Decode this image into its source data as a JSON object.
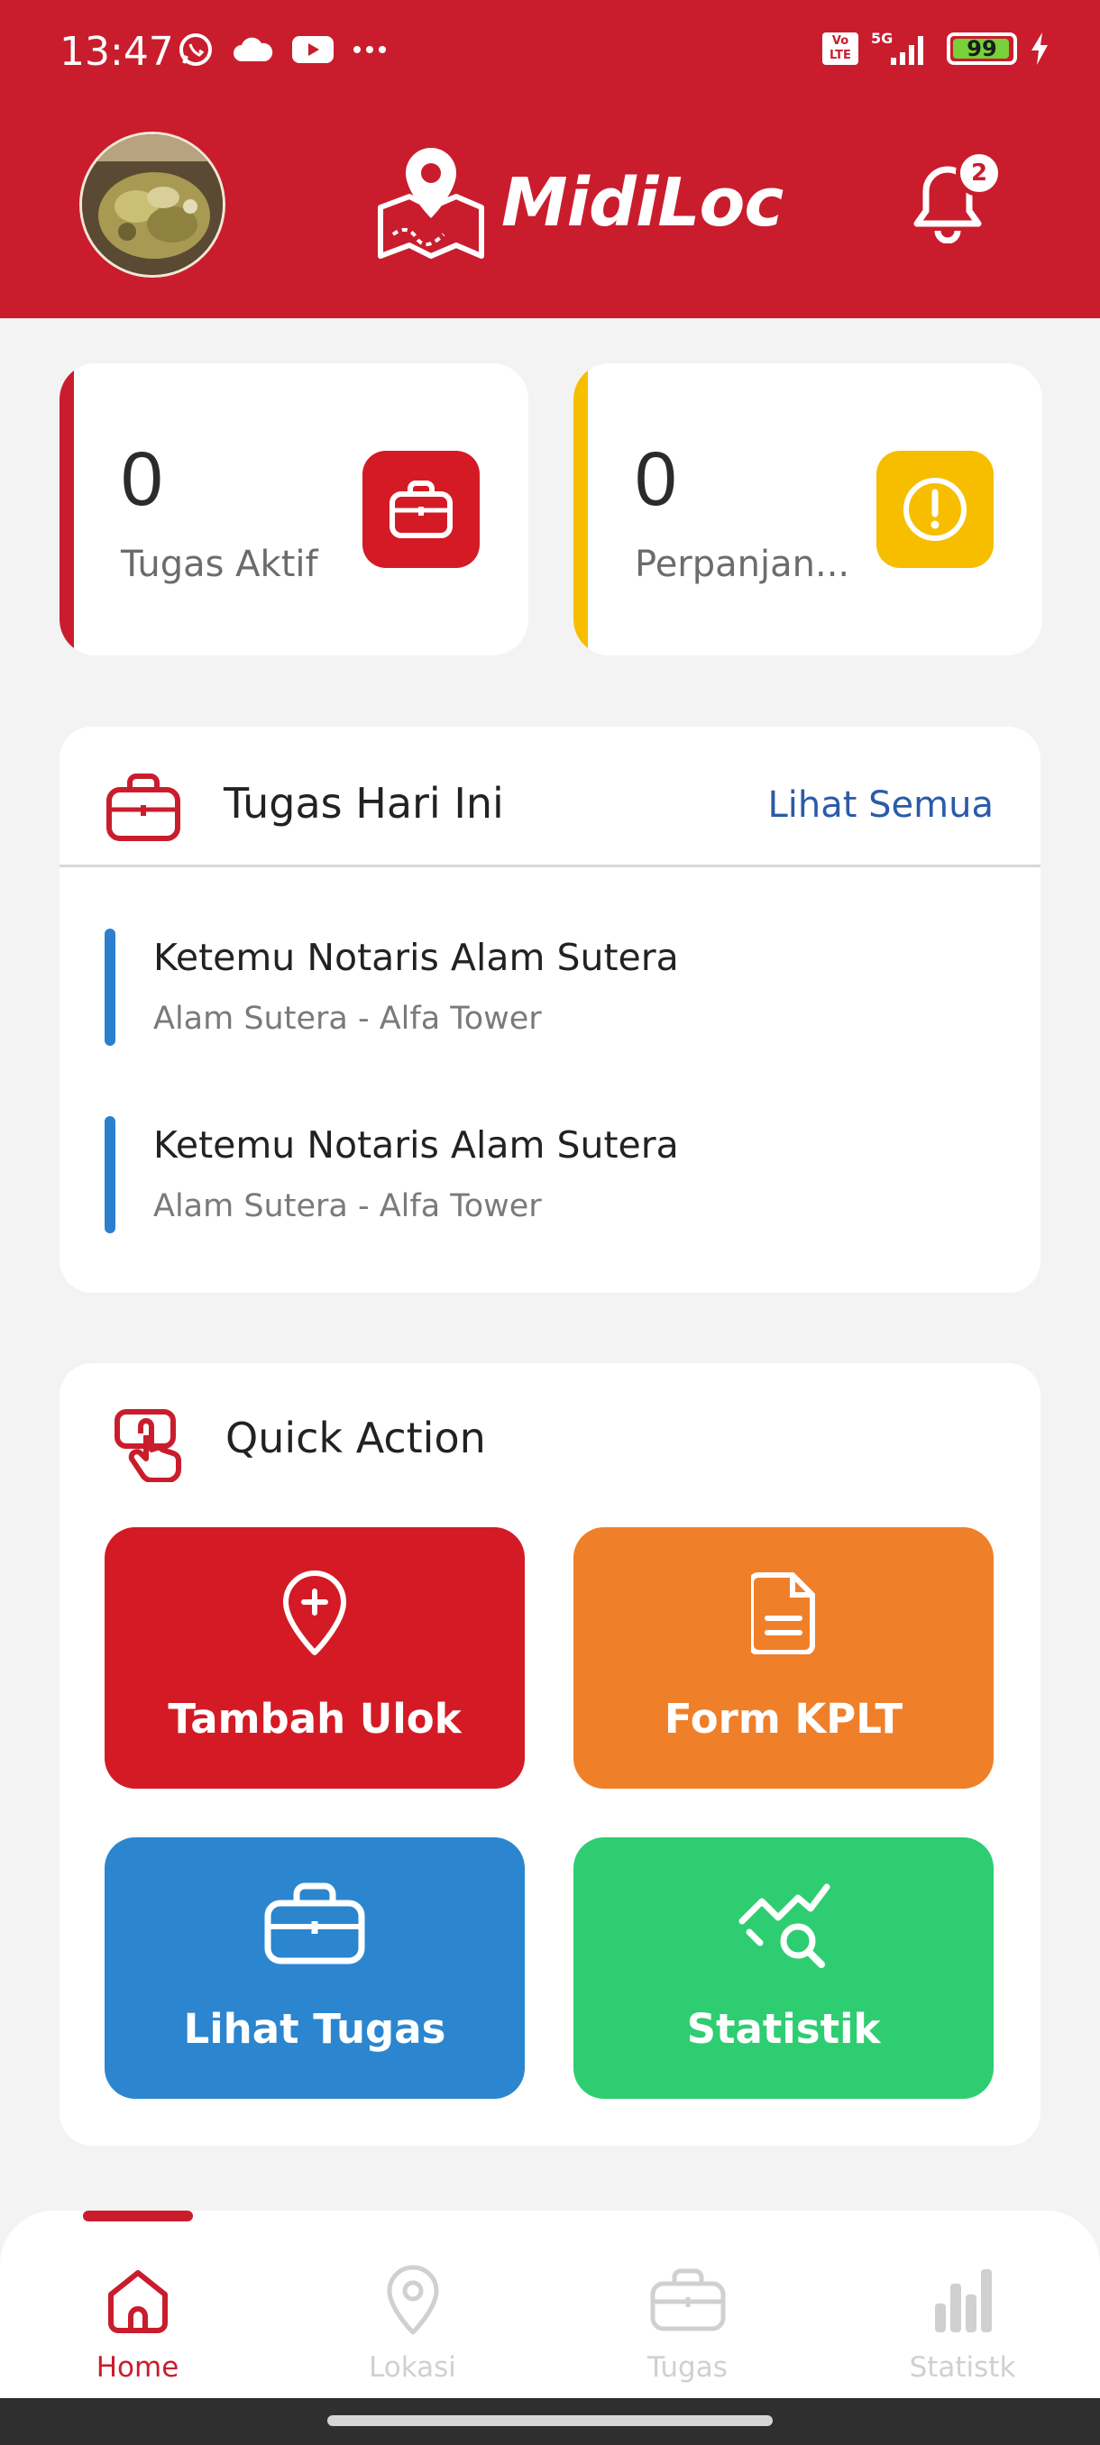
{
  "status_bar": {
    "time": "13:47",
    "volte": "Vo\nLTE",
    "network": "5G",
    "battery": "99"
  },
  "header": {
    "app_name": "MidiLoc",
    "notification_count": "2",
    "brand_color": "#c91d2d"
  },
  "stats": [
    {
      "value": "0",
      "label": "Tugas Aktif",
      "accent": "#c91d2d",
      "icon": "briefcase-icon"
    },
    {
      "value": "0",
      "label": "Perpanjan...",
      "accent": "#f7be00",
      "icon": "alert-icon"
    }
  ],
  "today": {
    "title": "Tugas Hari Ini",
    "see_all": "Lihat Semua",
    "tasks": [
      {
        "title": "Ketemu Notaris Alam Sutera",
        "location": "Alam Sutera - Alfa Tower"
      },
      {
        "title": "Ketemu Notaris Alam Sutera",
        "location": "Alam Sutera - Alfa Tower"
      }
    ]
  },
  "quick_action": {
    "title": "Quick Action",
    "buttons": [
      {
        "label": "Tambah Ulok",
        "color": "#d41b25",
        "icon": "location-add-icon"
      },
      {
        "label": "Form KPLT",
        "color": "#f07f2a",
        "icon": "document-icon"
      },
      {
        "label": "Lihat Tugas",
        "color": "#2b86cf",
        "icon": "briefcase-icon"
      },
      {
        "label": "Statistik",
        "color": "#2ecd71",
        "icon": "chart-search-icon"
      }
    ]
  },
  "bottom_nav": {
    "items": [
      {
        "label": "Home",
        "icon": "home-icon",
        "active": true
      },
      {
        "label": "Lokasi",
        "icon": "location-icon",
        "active": false
      },
      {
        "label": "Tugas",
        "icon": "briefcase-icon",
        "active": false
      },
      {
        "label": "Statistk",
        "icon": "bar-chart-icon",
        "active": false
      }
    ]
  }
}
